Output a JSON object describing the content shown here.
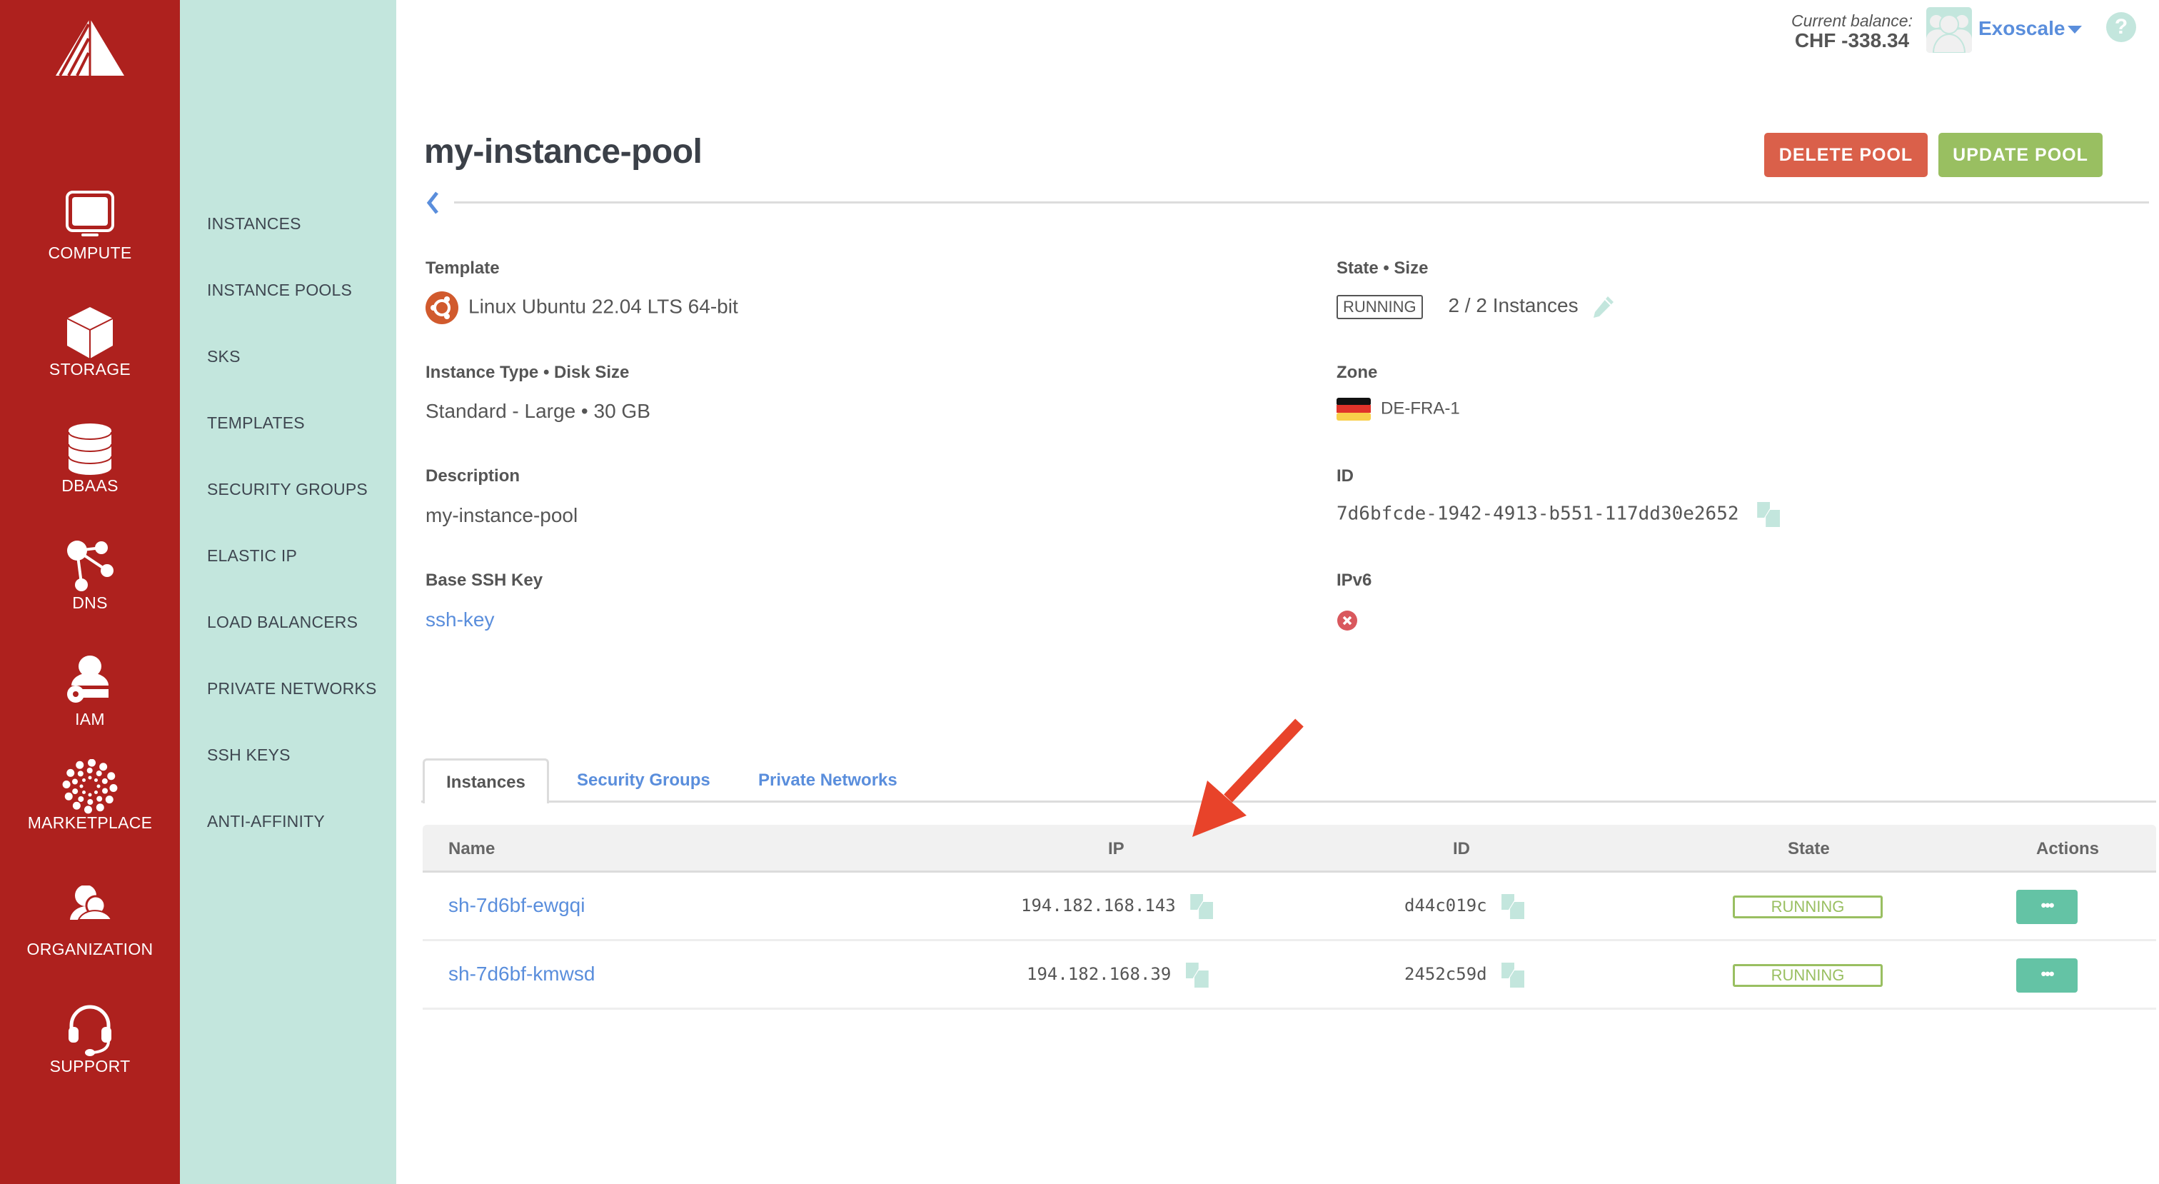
{
  "rail": {
    "items": [
      {
        "label": "COMPUTE",
        "icon": "monitor-icon"
      },
      {
        "label": "STORAGE",
        "icon": "cube-icon"
      },
      {
        "label": "DBAAS",
        "icon": "database-icon"
      },
      {
        "label": "DNS",
        "icon": "share-nodes-icon"
      },
      {
        "label": "IAM",
        "icon": "user-key-icon"
      },
      {
        "label": "MARKETPLACE",
        "icon": "dots-burst-icon"
      },
      {
        "label": "ORGANIZATION",
        "icon": "users-icon"
      },
      {
        "label": "SUPPORT",
        "icon": "headset-icon"
      }
    ]
  },
  "subnav": {
    "items": [
      "INSTANCES",
      "INSTANCE POOLS",
      "SKS",
      "TEMPLATES",
      "SECURITY GROUPS",
      "ELASTIC IP",
      "LOAD BALANCERS",
      "PRIVATE NETWORKS",
      "SSH KEYS",
      "ANTI-AFFINITY"
    ]
  },
  "header": {
    "balance_caption": "Current balance:",
    "balance_value": "CHF -338.34",
    "organization": "Exoscale",
    "help": "?"
  },
  "page": {
    "title": "my-instance-pool",
    "delete_label": "DELETE POOL",
    "update_label": "UPDATE POOL"
  },
  "details": {
    "template_label": "Template",
    "template_value": "Linux Ubuntu 22.04 LTS 64-bit",
    "type_label": "Instance Type • Disk Size",
    "type_value": "Standard - Large • 30 GB",
    "description_label": "Description",
    "description_value": "my-instance-pool",
    "ssh_label": "Base SSH Key",
    "ssh_value": "ssh-key",
    "state_label": "State • Size",
    "state_value": "RUNNING",
    "size_value": "2 / 2 Instances",
    "zone_label": "Zone",
    "zone_value": "DE-FRA-1",
    "id_label": "ID",
    "id_value": "7d6bfcde-1942-4913-b551-117dd30e2652",
    "ipv6_label": "IPv6",
    "ipv6_enabled": false
  },
  "tabs": [
    {
      "label": "Instances",
      "active": true
    },
    {
      "label": "Security Groups",
      "active": false
    },
    {
      "label": "Private Networks",
      "active": false
    }
  ],
  "table": {
    "columns": [
      "Name",
      "IP",
      "ID",
      "State",
      "Actions"
    ],
    "rows": [
      {
        "name": "sh-7d6bf-ewgqi",
        "ip": "194.182.168.143",
        "id": "d44c019c",
        "state": "RUNNING",
        "action": "•••"
      },
      {
        "name": "sh-7d6bf-kmwsd",
        "ip": "194.182.168.39",
        "id": "2452c59d",
        "state": "RUNNING",
        "action": "•••"
      }
    ]
  },
  "colors": {
    "rail": "#ae211e",
    "subnav": "#c3e6dd",
    "link": "#5a8edc",
    "delete": "#da604a",
    "update": "#99bf61",
    "action": "#64c3a5",
    "annotation_arrow": "#e8432a"
  }
}
